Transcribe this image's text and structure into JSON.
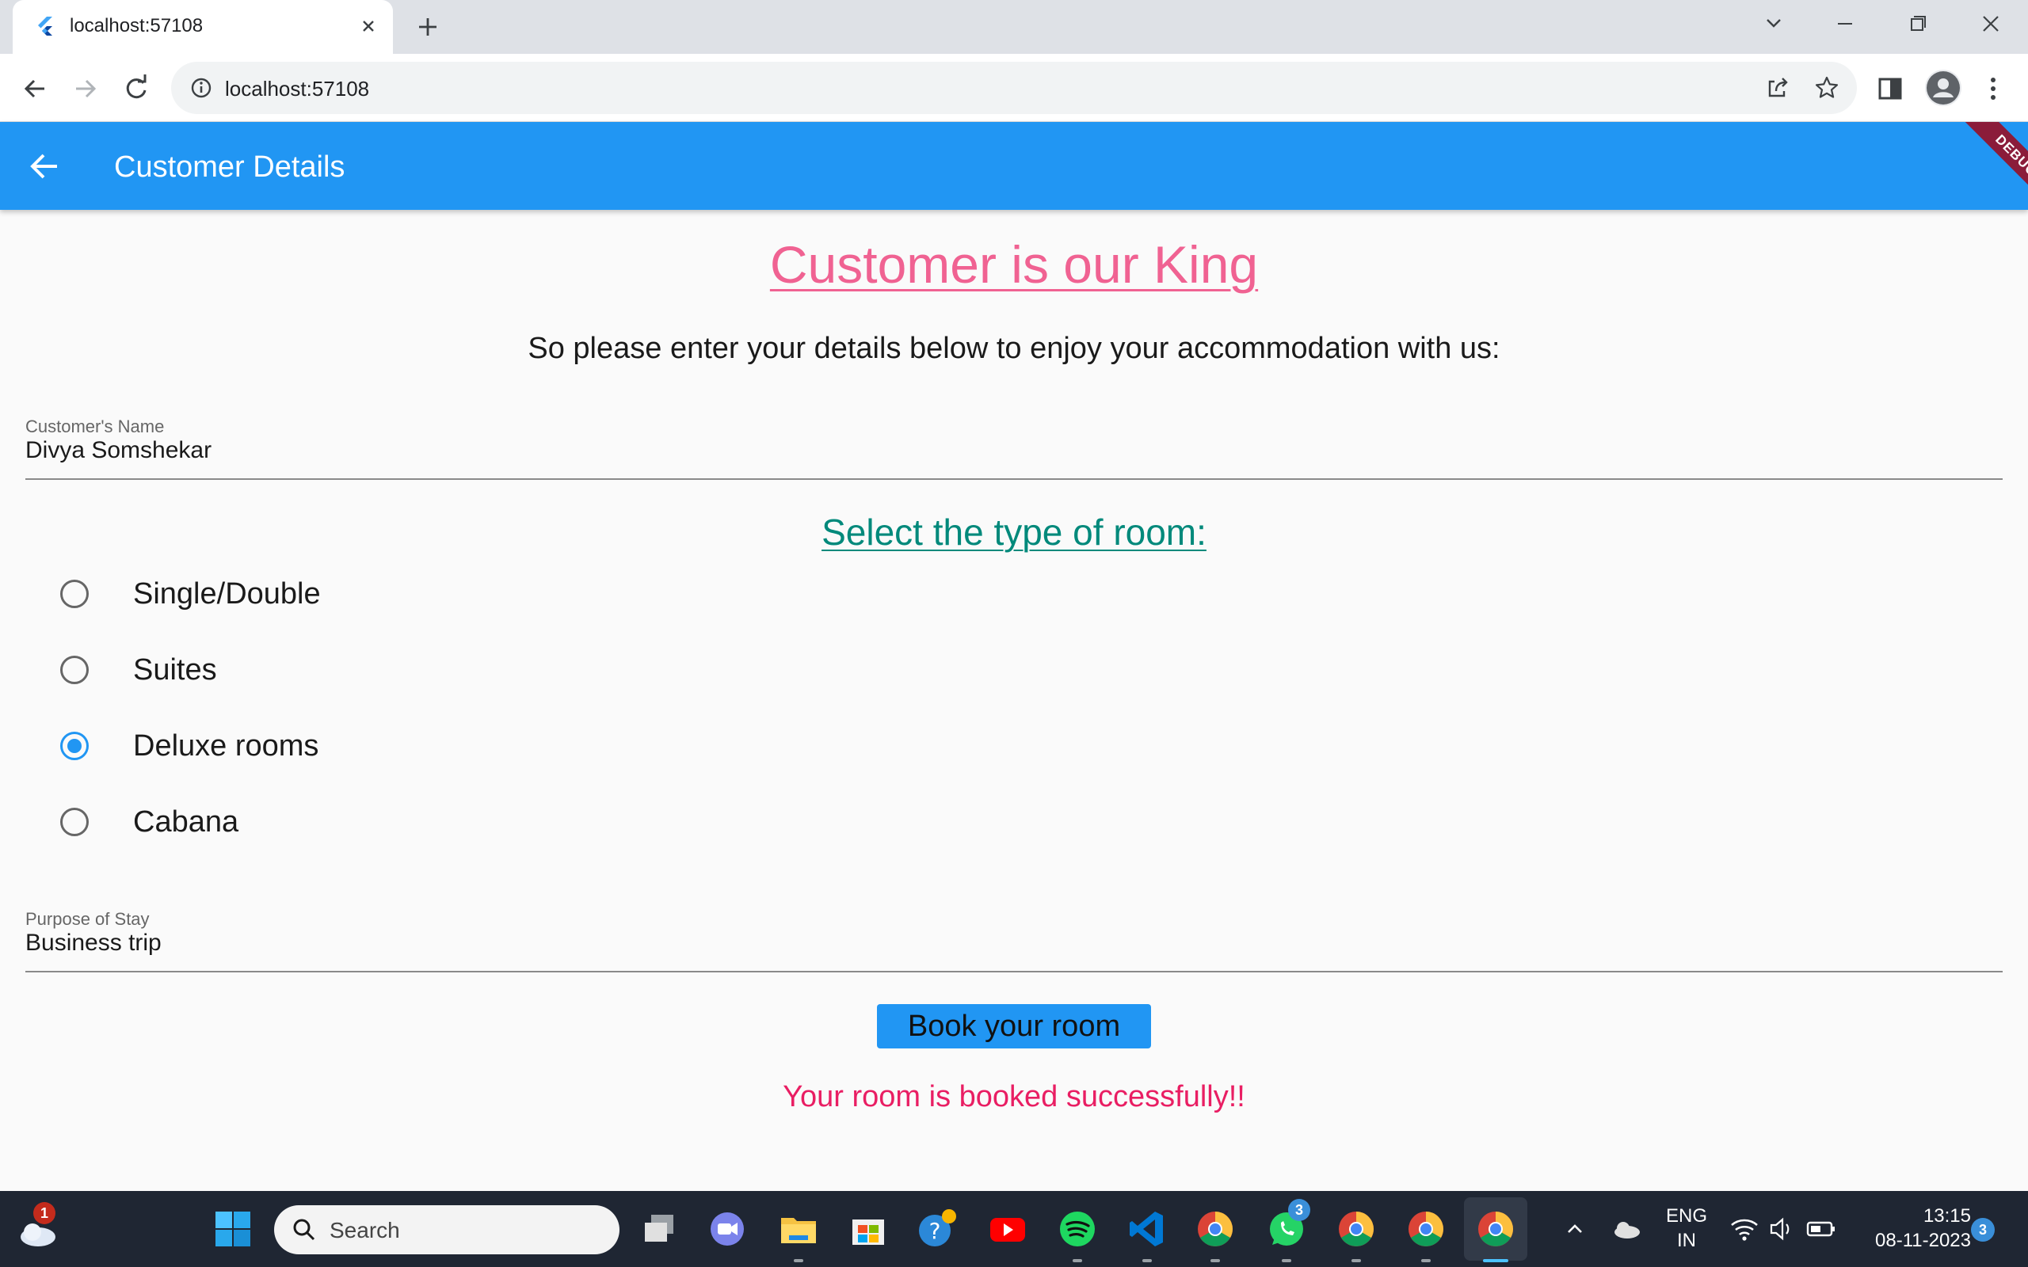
{
  "browser": {
    "tab_title": "localhost:57108",
    "url": "localhost:57108"
  },
  "app": {
    "title": "Customer Details",
    "debug_banner": "DEBUG",
    "headline": "Customer is our King",
    "subline": "So please enter your details below to enjoy your accommodation with us:",
    "name_field": {
      "label": "Customer's Name",
      "value": "Divya Somshekar"
    },
    "room_section_title": "Select the type of room:",
    "room_options": [
      {
        "label": "Single/Double",
        "selected": false
      },
      {
        "label": "Suites",
        "selected": false
      },
      {
        "label": "Deluxe rooms",
        "selected": true
      },
      {
        "label": "Cabana",
        "selected": false
      }
    ],
    "purpose_field": {
      "label": "Purpose of Stay",
      "value": "Business trip"
    },
    "book_button": "Book your room",
    "success_message": "Your room is booked successfully!!",
    "colors": {
      "primary": "#2196f3",
      "headline": "#f06292",
      "section": "#00897b",
      "success": "#e91e63"
    }
  },
  "taskbar": {
    "search_placeholder": "Search",
    "weather_badge": "1",
    "whatsapp_badge": "3",
    "language": "ENG",
    "region": "IN",
    "time": "13:15",
    "date": "08-11-2023",
    "notification_count": "3"
  }
}
